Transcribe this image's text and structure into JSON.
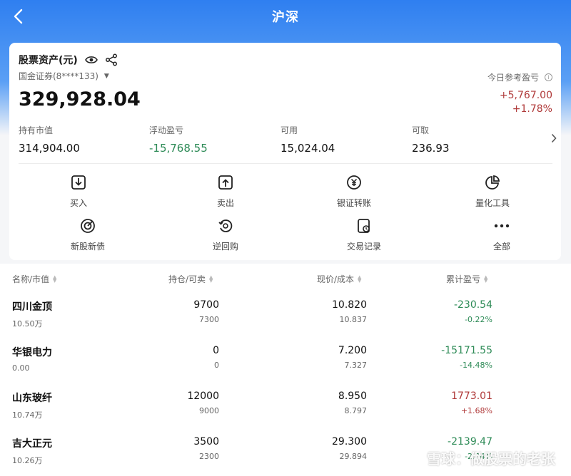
{
  "header": {
    "title": "沪深"
  },
  "assets": {
    "label": "股票资产(元)",
    "account": "国金证券(8****133)",
    "total": "329,928.04",
    "today_pnl_label": "今日参考盈亏",
    "today_pnl_amount": "+5,767.00",
    "today_pnl_pct": "+1.78%"
  },
  "stats": [
    {
      "label": "持有市值",
      "value": "314,904.00"
    },
    {
      "label": "浮动盈亏",
      "value": "-15,768.55"
    },
    {
      "label": "可用",
      "value": "15,024.04"
    },
    {
      "label": "可取",
      "value": "236.93"
    }
  ],
  "tools": [
    {
      "label": "买入",
      "icon": "buy-icon"
    },
    {
      "label": "卖出",
      "icon": "sell-icon"
    },
    {
      "label": "银证转账",
      "icon": "transfer-icon"
    },
    {
      "label": "量化工具",
      "icon": "pie-chart-icon"
    },
    {
      "label": "新股新债",
      "icon": "target-icon"
    },
    {
      "label": "逆回购",
      "icon": "repo-icon"
    },
    {
      "label": "交易记录",
      "icon": "record-icon"
    },
    {
      "label": "全部",
      "icon": "more-icon"
    }
  ],
  "table": {
    "headers": [
      "名称/市值",
      "持仓/可卖",
      "现价/成本",
      "累计盈亏"
    ],
    "rows": [
      {
        "name": "四川金顶",
        "value": "10.50万",
        "position": "9700",
        "sellable": "7300",
        "price": "10.820",
        "cost": "10.837",
        "pnl": "-230.54",
        "pnl_pct": "-0.22%"
      },
      {
        "name": "华银电力",
        "value": "0.00",
        "position": "0",
        "sellable": "0",
        "price": "7.200",
        "cost": "7.327",
        "pnl": "-15171.55",
        "pnl_pct": "-14.48%"
      },
      {
        "name": "山东玻纤",
        "value": "10.74万",
        "position": "12000",
        "sellable": "9000",
        "price": "8.950",
        "cost": "8.797",
        "pnl": "1773.01",
        "pnl_pct": "+1.68%"
      },
      {
        "name": "吉大正元",
        "value": "10.26万",
        "position": "3500",
        "sellable": "2300",
        "price": "29.300",
        "cost": "29.894",
        "pnl": "-2139.47",
        "pnl_pct": "-2.04%"
      }
    ]
  },
  "watermark": "雪球：做股票的老张",
  "colors": {
    "header_blue": "#2f7ff0",
    "loss_green": "#2e8b57",
    "gain_red": "#b03a3a"
  }
}
